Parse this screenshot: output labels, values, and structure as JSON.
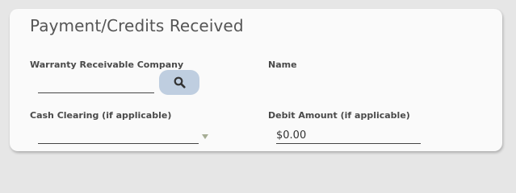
{
  "section": {
    "title": "Payment/Credits Received"
  },
  "fields": {
    "warranty_company": {
      "label": "Warranty Receivable Company",
      "value": ""
    },
    "name": {
      "label": "Name",
      "value": ""
    },
    "cash_clearing": {
      "label": "Cash Clearing (if applicable)",
      "selected": ""
    },
    "debit_amount": {
      "label": "Debit Amount (if applicable)",
      "value": "$0.00"
    }
  },
  "icons": {
    "search": "search-icon",
    "dropdown": "caret-down-icon"
  },
  "colors": {
    "search_button_bg": "#bfcee0",
    "caret": "#a6ad95",
    "card_bg": "#fafafa",
    "page_bg": "#e6e6e6"
  }
}
